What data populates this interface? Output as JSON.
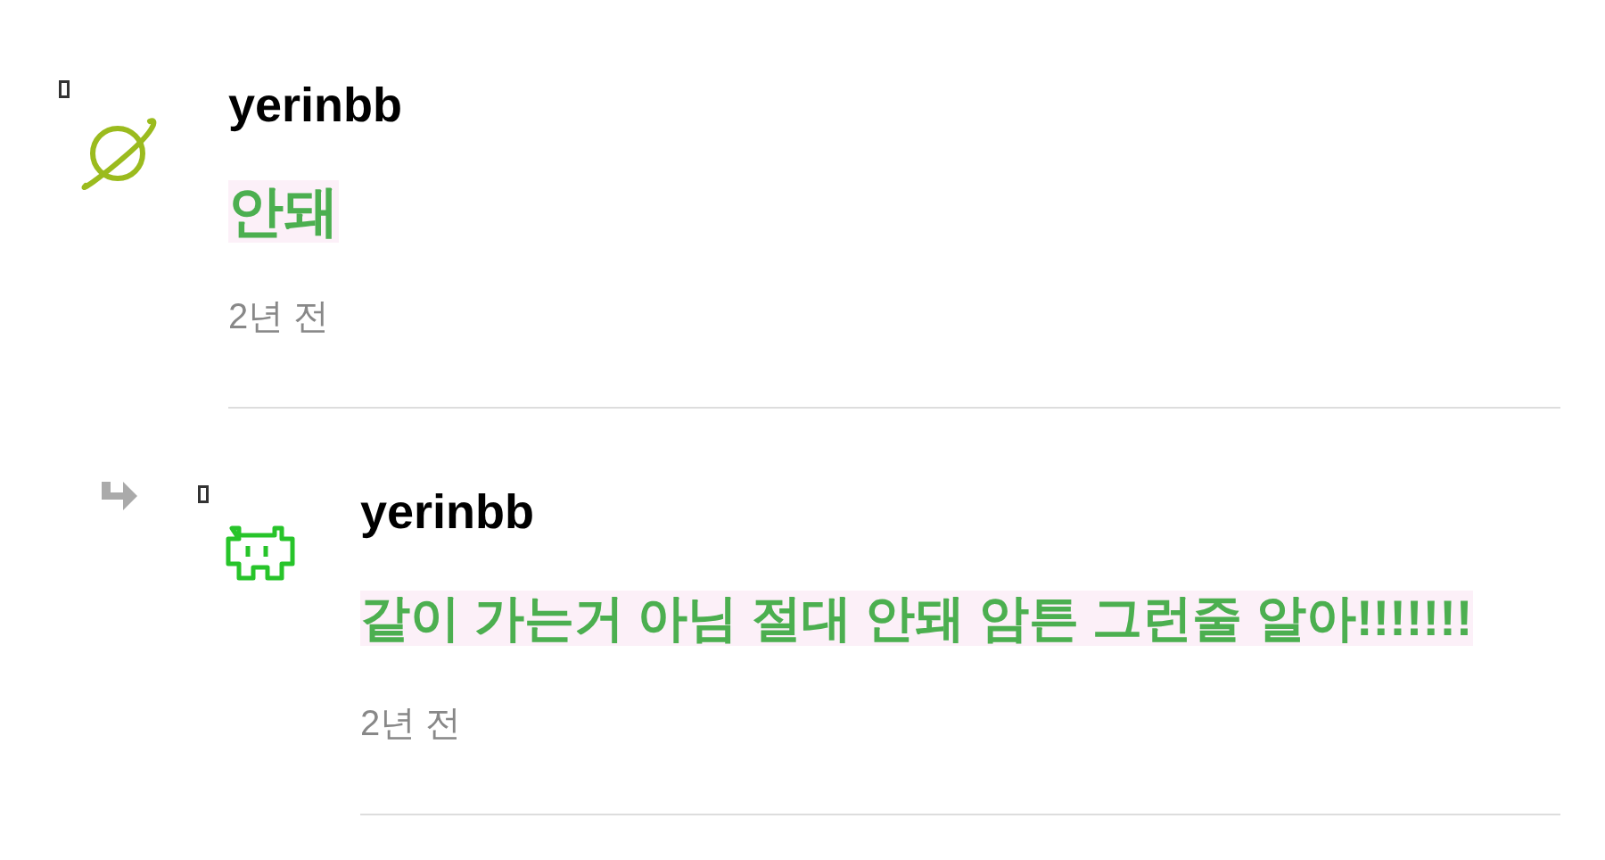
{
  "comments": [
    {
      "author": "yerinbb",
      "text": "안돼",
      "time": "2년 전",
      "kind": "planet",
      "children": [
        {
          "author": "yerinbb",
          "text": "같이 가는거 아님 절대 안돼 암튼 그런줄 알아!!!!!!!",
          "time": "2년 전",
          "kind": "invader"
        }
      ]
    }
  ]
}
